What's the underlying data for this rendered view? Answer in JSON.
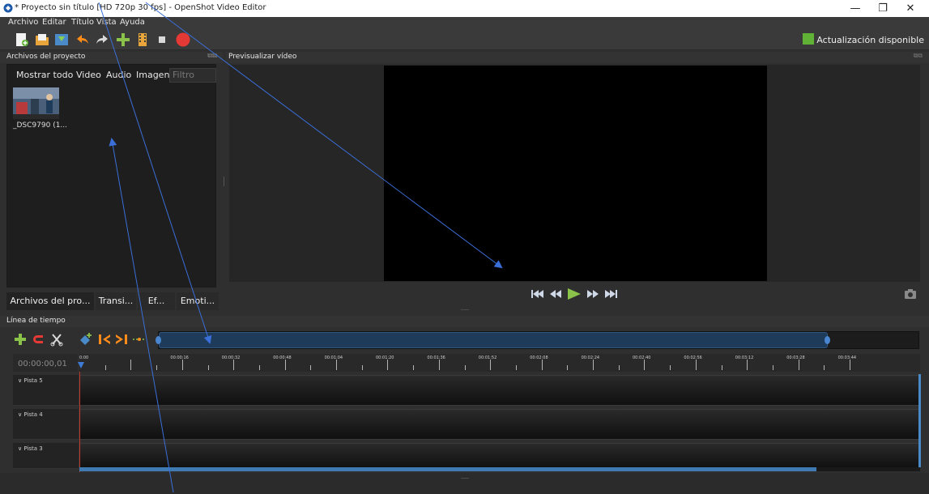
{
  "window": {
    "title": "* Proyecto sin título [HD 720p 30 fps] - OpenShot Video Editor",
    "icon": "openshot-app-icon",
    "minimize": "—",
    "restore": "❐",
    "close": "✕"
  },
  "menu": {
    "items": [
      "Archivo",
      "Editar",
      "Título",
      "Vista",
      "Ayuda"
    ]
  },
  "toolbar": {
    "update_label": "Actualización disponible",
    "icons": [
      "new-project-icon",
      "open-project-icon",
      "save-project-icon",
      "undo-icon",
      "redo-icon",
      "import-files-icon",
      "choose-profile-icon",
      "fullscreen-icon",
      "export-video-icon"
    ]
  },
  "project_files": {
    "dock_title": "Archivos del proyecto",
    "filters": [
      "Mostrar todo",
      "Video",
      "Audio",
      "Imagen"
    ],
    "filter_placeholder": "Filtro",
    "files": [
      {
        "name": "_DSC9790 (1..."
      }
    ]
  },
  "bottom_tabs": [
    "Archivos del pro...",
    "Transi...",
    "Ef...",
    "Emoti..."
  ],
  "preview": {
    "dock_title": "Previsualizar vídeo",
    "controls": [
      "jump-start-icon",
      "rewind-icon",
      "play-icon",
      "fast-forward-icon",
      "jump-end-icon"
    ]
  },
  "timeline": {
    "dock_title": "Línea de tiempo",
    "current_time": "00:00:00,01",
    "tools": [
      "add-track-icon",
      "snap-icon",
      "razor-icon",
      "add-marker-icon",
      "previous-marker-icon",
      "next-marker-icon",
      "center-timeline-icon"
    ],
    "ruler_labels": [
      "0:00",
      "00:00:16",
      "00:00:32",
      "00:00:48",
      "00:01:04",
      "00:01:20",
      "00:01:36",
      "00:01:52",
      "00:02:08",
      "00:02:24",
      "00:02:40",
      "00:02:56",
      "00:03:12",
      "00:03:28",
      "00:03:44"
    ],
    "tracks": [
      "Pista 5",
      "Pista 4",
      "Pista 3"
    ]
  },
  "colors": {
    "accent_blue": "#3d7bd6",
    "play_green": "#8bc34a",
    "record_red": "#e53935",
    "marker_orange": "#ff8c1a"
  }
}
